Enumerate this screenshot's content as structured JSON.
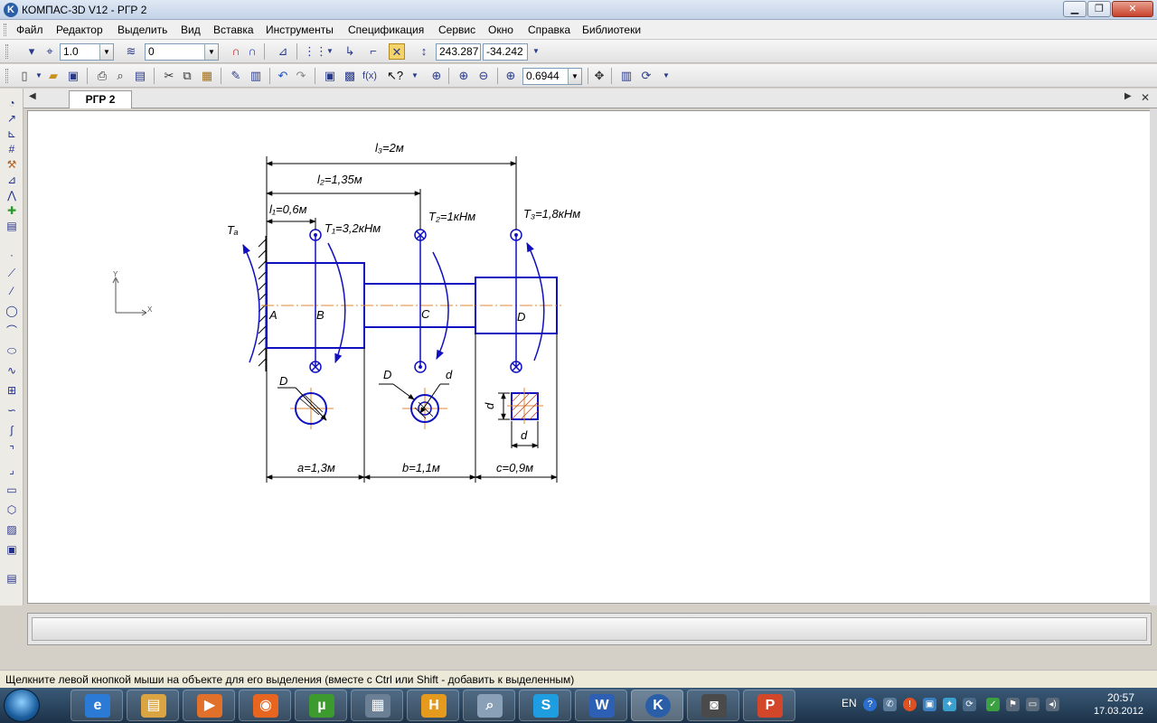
{
  "window": {
    "title": "КОМПАС-3D V12 - РГР 2",
    "app_icon": "K"
  },
  "menu": [
    "Файл",
    "Редактор",
    "Выделить",
    "Вид",
    "Вставка",
    "Инструменты",
    "Спецификация",
    "Сервис",
    "Окно",
    "Справка",
    "Библиотеки"
  ],
  "toolbar1": {
    "step_value": "1.0",
    "layer_value": "0",
    "coord_x": "243.287",
    "coord_y": "-34.242"
  },
  "toolbar2": {
    "zoom_value": "0.6944"
  },
  "document": {
    "tab_label": "РГР 2"
  },
  "drawing": {
    "dims": {
      "l3": "l₃=2м",
      "l2": "l₂=1,35м",
      "l1": "l₁=0,6м",
      "a": "a=1,3м",
      "b": "b=1,1м",
      "c": "c=0,9м"
    },
    "torques": {
      "TA": "Tₐ",
      "T1": "T₁=3,2кНм",
      "T2": "T₂=1кНм",
      "T3": "T₃=1,8кНм"
    },
    "points": {
      "A": "A",
      "B": "B",
      "C": "C",
      "D": "D"
    },
    "section_labels": {
      "D1": "D",
      "D2": "D",
      "d2": "d",
      "d3v": "d",
      "d3h": "d"
    },
    "axis_y": "Y",
    "axis_x": "X"
  },
  "status": "Щелкните левой кнопкой мыши на объекте для его выделения (вместе с Ctrl или Shift - добавить к выделенным)",
  "taskbar": {
    "lang": "EN",
    "time": "20:57",
    "date": "17.03.2012",
    "apps": [
      {
        "name": "internet-explorer",
        "glyph": "e",
        "color": "#2b7bd6"
      },
      {
        "name": "file-explorer",
        "glyph": "▤",
        "color": "#d9a441"
      },
      {
        "name": "media-player",
        "glyph": "▶",
        "color": "#e0702a"
      },
      {
        "name": "firefox",
        "glyph": "◉",
        "color": "#e8651f"
      },
      {
        "name": "utorrent",
        "glyph": "µ",
        "color": "#3c9a2e"
      },
      {
        "name": "calculator",
        "glyph": "▦",
        "color": "#6b7f95"
      },
      {
        "name": "h-app",
        "glyph": "H",
        "color": "#e59a1d"
      },
      {
        "name": "image-viewer",
        "glyph": "⌕",
        "color": "#8aa0b6"
      },
      {
        "name": "skype",
        "glyph": "S",
        "color": "#1e9ee0"
      },
      {
        "name": "word",
        "glyph": "W",
        "color": "#2d5fb4"
      },
      {
        "name": "kompas",
        "glyph": "K",
        "color": "#2a5fa8"
      },
      {
        "name": "camera",
        "glyph": "◙",
        "color": "#4a4a4a"
      },
      {
        "name": "powerpoint",
        "glyph": "P",
        "color": "#d2472a"
      }
    ]
  }
}
